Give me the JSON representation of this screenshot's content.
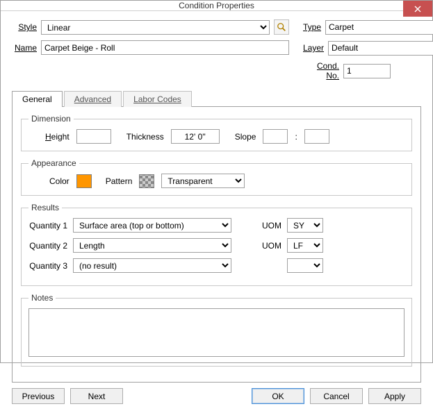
{
  "window": {
    "title": "Condition Properties"
  },
  "fields": {
    "style": {
      "label": "Style",
      "value": "Linear"
    },
    "name": {
      "label": "Name",
      "value": "Carpet Beige - Roll"
    },
    "type": {
      "label": "Type",
      "value": "Carpet"
    },
    "layer": {
      "label": "Layer",
      "value": "Default"
    },
    "condno": {
      "label": "Cond. No.",
      "value": "1"
    }
  },
  "tabs": {
    "general": "General",
    "advanced": "Advanced",
    "laborcodes": "Labor Codes"
  },
  "dimension": {
    "legend": "Dimension",
    "height_label": "Height",
    "height_value": "",
    "thickness_label": "Thickness",
    "thickness_value": "12' 0''",
    "slope_label": "Slope",
    "slope_a": "",
    "slope_sep": ":",
    "slope_b": ""
  },
  "appearance": {
    "legend": "Appearance",
    "color_label": "Color",
    "color_value": "#ff9600",
    "pattern_label": "Pattern",
    "pattern_value": "Transparent"
  },
  "results": {
    "legend": "Results",
    "q1_label": "Quantity 1",
    "q1_value": "Surface area (top or bottom)",
    "uom_label": "UOM",
    "q1_uom": "SY",
    "q2_label": "Quantity 2",
    "q2_value": "Length",
    "q2_uom": "LF",
    "q3_label": "Quantity 3",
    "q3_value": "(no result)",
    "q3_uom": ""
  },
  "notes": {
    "legend": "Notes",
    "value": ""
  },
  "buttons": {
    "previous": "Previous",
    "next": "Next",
    "ok": "OK",
    "cancel": "Cancel",
    "apply": "Apply"
  }
}
